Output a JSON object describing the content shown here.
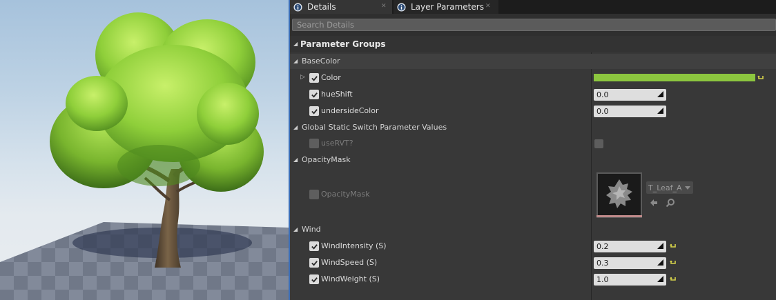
{
  "tabs": [
    {
      "label": "Details",
      "icon": "info-icon",
      "active": true
    },
    {
      "label": "Layer Parameters",
      "icon": "info-icon",
      "active": false
    }
  ],
  "search": {
    "placeholder": "Search Details",
    "value": ""
  },
  "header": {
    "title": "Parameter Groups"
  },
  "groups": {
    "basecolor": {
      "label": "BaseColor",
      "color": {
        "label": "Color",
        "checked": true,
        "value_hex": "#8cc63f"
      },
      "hueshift": {
        "label": "hueShift",
        "checked": true,
        "value": "0.0"
      },
      "undersidecolor": {
        "label": "undersideColor",
        "checked": true,
        "value": "0.0"
      }
    },
    "staticswitch": {
      "label": "Global Static Switch Parameter Values",
      "usertv": {
        "label": "useRVT?",
        "checked": false,
        "enabled": false
      }
    },
    "opacitymask": {
      "label": "OpacityMask",
      "param": {
        "label": "OpacityMask",
        "enabled": false,
        "texture": "T_Leaf_A"
      }
    },
    "wind": {
      "label": "Wind",
      "intensity": {
        "label": "WindIntensity (S)",
        "checked": true,
        "value": "0.2"
      },
      "speed": {
        "label": "WindSpeed (S)",
        "checked": true,
        "value": "0.3"
      },
      "weight": {
        "label": "WindWeight (S)",
        "checked": true,
        "value": "1.0"
      }
    }
  },
  "colors": {
    "accent": "#3b6db5",
    "basecolor_swatch": "#8cc63f",
    "reset": "#d6d24a"
  }
}
